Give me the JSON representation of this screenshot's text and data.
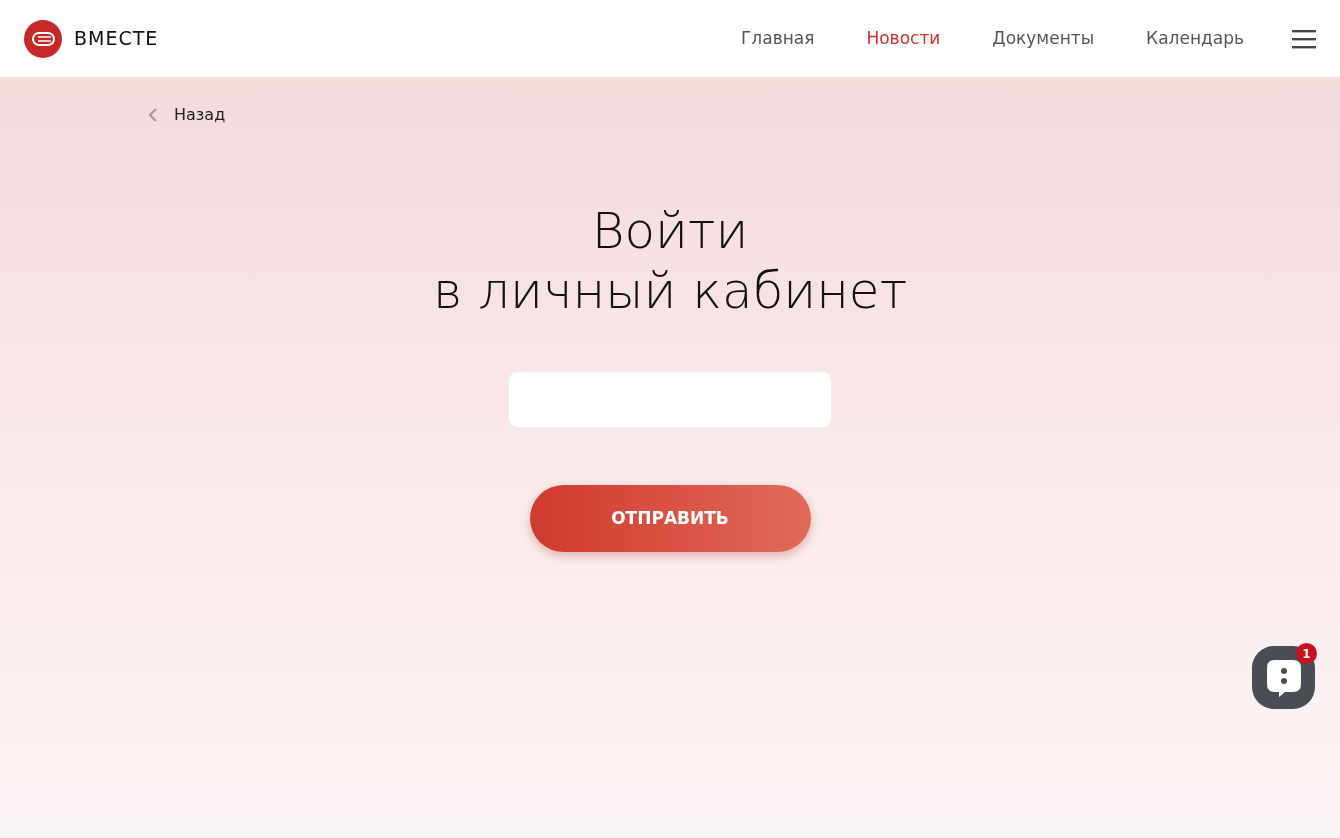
{
  "header": {
    "logo_text": "ВМЕСТЕ",
    "nav": [
      {
        "label": "Главная",
        "selected": false
      },
      {
        "label": "Новости",
        "selected": true
      },
      {
        "label": "Документы",
        "selected": false
      },
      {
        "label": "Календарь",
        "selected": false
      }
    ]
  },
  "back_link": "Назад",
  "title_lines": [
    "Войти",
    "в личный кабинет"
  ],
  "submit_button": "ОТПРАВИТЬ",
  "chat_widget": {
    "badge": "1"
  }
}
